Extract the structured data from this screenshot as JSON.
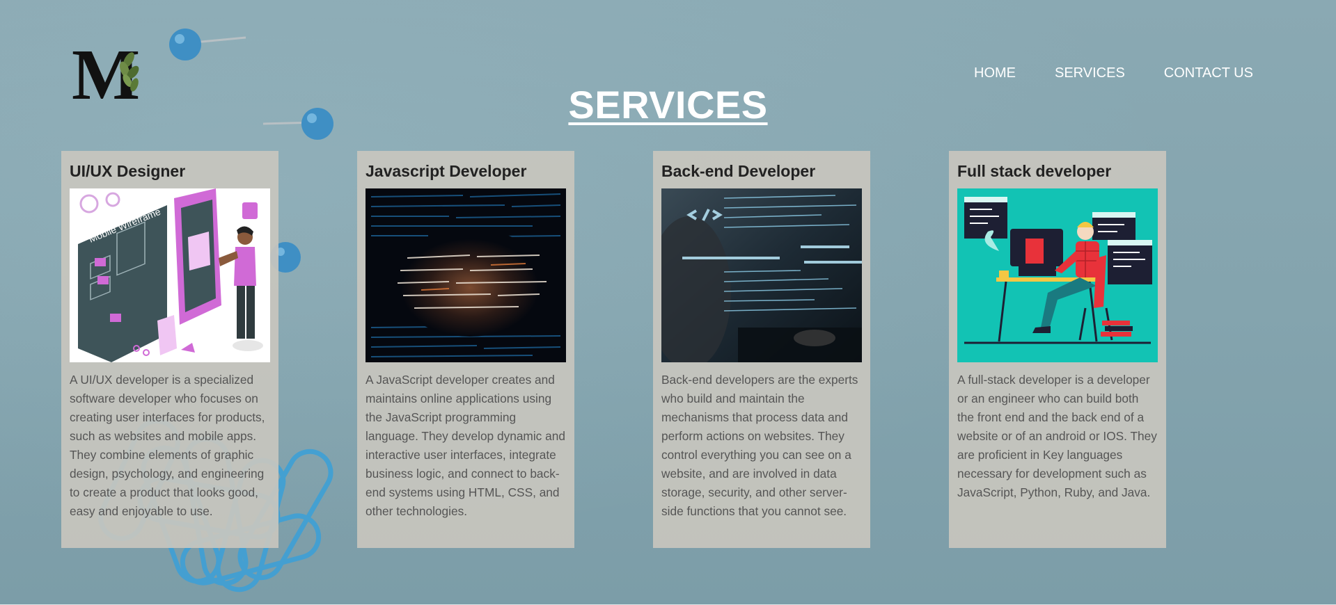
{
  "nav": {
    "items": [
      {
        "label": "HOME"
      },
      {
        "label": "SERVICES"
      },
      {
        "label": "CONTACT US"
      }
    ]
  },
  "logo": {
    "letter": "M"
  },
  "page": {
    "title": "SERVICES"
  },
  "cards": [
    {
      "title": "UI/UX Designer",
      "image_text": "Mobile Wireframe",
      "description": "A UI/UX developer is a specialized software developer who focuses on creating user interfaces for products, such as websites and mobile apps. They combine elements of graphic design, psychology, and engineering to create a product that looks good, easy and enjoyable to use."
    },
    {
      "title": "Javascript Developer",
      "description": "A JavaScript developer creates and maintains online applications using the JavaScript programming language. They develop dynamic and interactive user interfaces, integrate business logic, and connect to back-end systems using HTML, CSS, and other technologies."
    },
    {
      "title": "Back-end Developer",
      "description": "Back-end developers are the experts who build and maintain the mechanisms that process data and perform actions on websites. They control everything you can see on a website, and are involved in data storage, security, and other server-side functions that you cannot see."
    },
    {
      "title": "Full stack developer",
      "description": "A full-stack developer is a developer or an engineer who can build both the front end and the back end of a website or of an android or IOS. They are proficient in Key languages necessary for development such as JavaScript, Python, Ruby, and Java."
    }
  ]
}
